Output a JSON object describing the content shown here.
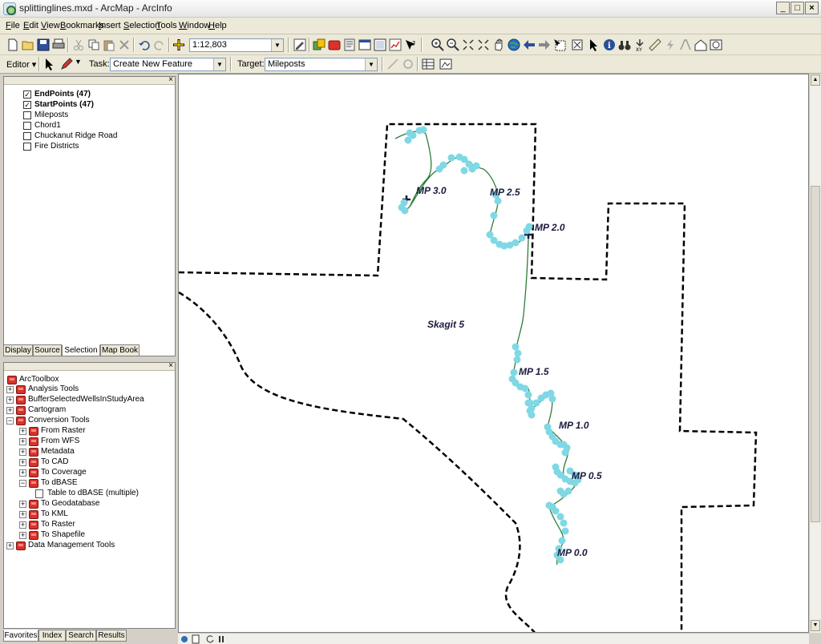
{
  "window": {
    "title": "splittinglines.mxd - ArcMap - ArcInfo",
    "minimize": "_",
    "maximize": "□",
    "close": "×"
  },
  "menu": [
    {
      "label": "File",
      "u": "F",
      "rest": "ile"
    },
    {
      "label": "Edit",
      "u": "E",
      "rest": "dit"
    },
    {
      "label": "View",
      "u": "V",
      "rest": "iew"
    },
    {
      "label": "Bookmarks",
      "u": "B",
      "rest": "ookmarks"
    },
    {
      "label": "Insert",
      "u": "I",
      "rest": "nsert"
    },
    {
      "label": "Selection",
      "u": "S",
      "rest": "election"
    },
    {
      "label": "Tools",
      "u": "T",
      "rest": "ools"
    },
    {
      "label": "Window",
      "u": "W",
      "rest": "indow"
    },
    {
      "label": "Help",
      "u": "H",
      "rest": "elp"
    }
  ],
  "toolbar": {
    "scale": "1:12,803"
  },
  "editor": {
    "editor_label": "Editor ▾",
    "task_label": "Task:",
    "task_value": "Create New Feature",
    "target_label": "Target:",
    "target_value": "Mileposts"
  },
  "toc": {
    "layers": [
      {
        "name": "EndPoints (47)",
        "checked": true,
        "bold": true
      },
      {
        "name": "StartPoints (47)",
        "checked": true,
        "bold": true
      },
      {
        "name": "Mileposts",
        "checked": false,
        "bold": false
      },
      {
        "name": "Chord1",
        "checked": false,
        "bold": false
      },
      {
        "name": "Chuckanut Ridge Road",
        "checked": false,
        "bold": false
      },
      {
        "name": "Fire Districts",
        "checked": false,
        "bold": false
      }
    ],
    "tabs": [
      "Display",
      "Source",
      "Selection",
      "Map Book"
    ],
    "active_tab": "Selection"
  },
  "toolbox": {
    "root": "ArcToolbox",
    "items": [
      {
        "label": "Analysis Tools",
        "level": 1,
        "expander": "+",
        "icon": "toolbox"
      },
      {
        "label": "BufferSelectedWellsInStudyArea",
        "level": 1,
        "expander": "+",
        "icon": "toolbox"
      },
      {
        "label": "Cartogram",
        "level": 1,
        "expander": "+",
        "icon": "toolbox"
      },
      {
        "label": "Conversion Tools",
        "level": 1,
        "expander": "−",
        "icon": "toolbox"
      },
      {
        "label": "From Raster",
        "level": 2,
        "expander": "+",
        "icon": "toolset"
      },
      {
        "label": "From WFS",
        "level": 2,
        "expander": "+",
        "icon": "toolset"
      },
      {
        "label": "Metadata",
        "level": 2,
        "expander": "+",
        "icon": "toolset"
      },
      {
        "label": "To CAD",
        "level": 2,
        "expander": "+",
        "icon": "toolset"
      },
      {
        "label": "To Coverage",
        "level": 2,
        "expander": "+",
        "icon": "toolset"
      },
      {
        "label": "To dBASE",
        "level": 2,
        "expander": "−",
        "icon": "toolset"
      },
      {
        "label": "Table to dBASE (multiple)",
        "level": 3,
        "expander": "",
        "icon": "script"
      },
      {
        "label": "To Geodatabase",
        "level": 2,
        "expander": "+",
        "icon": "toolset"
      },
      {
        "label": "To KML",
        "level": 2,
        "expander": "+",
        "icon": "toolset"
      },
      {
        "label": "To Raster",
        "level": 2,
        "expander": "+",
        "icon": "toolset"
      },
      {
        "label": "To Shapefile",
        "level": 2,
        "expander": "+",
        "icon": "toolset"
      },
      {
        "label": "Data Management Tools",
        "level": 1,
        "expander": "+",
        "icon": "toolbox"
      }
    ],
    "tabs": [
      "Favorites",
      "Index",
      "Search",
      "Results"
    ],
    "active_tab": "Favorites"
  },
  "map": {
    "area_label": "Skagit 5",
    "mileposts": [
      "MP 3.0",
      "MP 2.5",
      "MP 2.0",
      "MP 1.5",
      "MP 1.0",
      "MP 0.5",
      "MP 0.0"
    ],
    "colors": {
      "points": "#7fd8e4",
      "route": "#2f7d3a",
      "boundary": "#000000",
      "labels": "#1b1b3f"
    }
  }
}
